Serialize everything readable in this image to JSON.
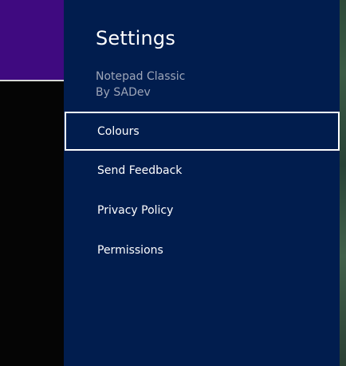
{
  "settings": {
    "title": "Settings",
    "app_name": "Notepad Classic",
    "publisher": "By SADev",
    "items": [
      {
        "label": "Colours",
        "focused": true
      },
      {
        "label": "Send Feedback",
        "focused": false
      },
      {
        "label": "Privacy Policy",
        "focused": false
      },
      {
        "label": "Permissions",
        "focused": false
      }
    ]
  },
  "colors": {
    "pane_background": "#011d4e",
    "app_header": "#3f0a80",
    "focus_border": "#ffffff",
    "subtitle_text": "#9ea6b8"
  }
}
